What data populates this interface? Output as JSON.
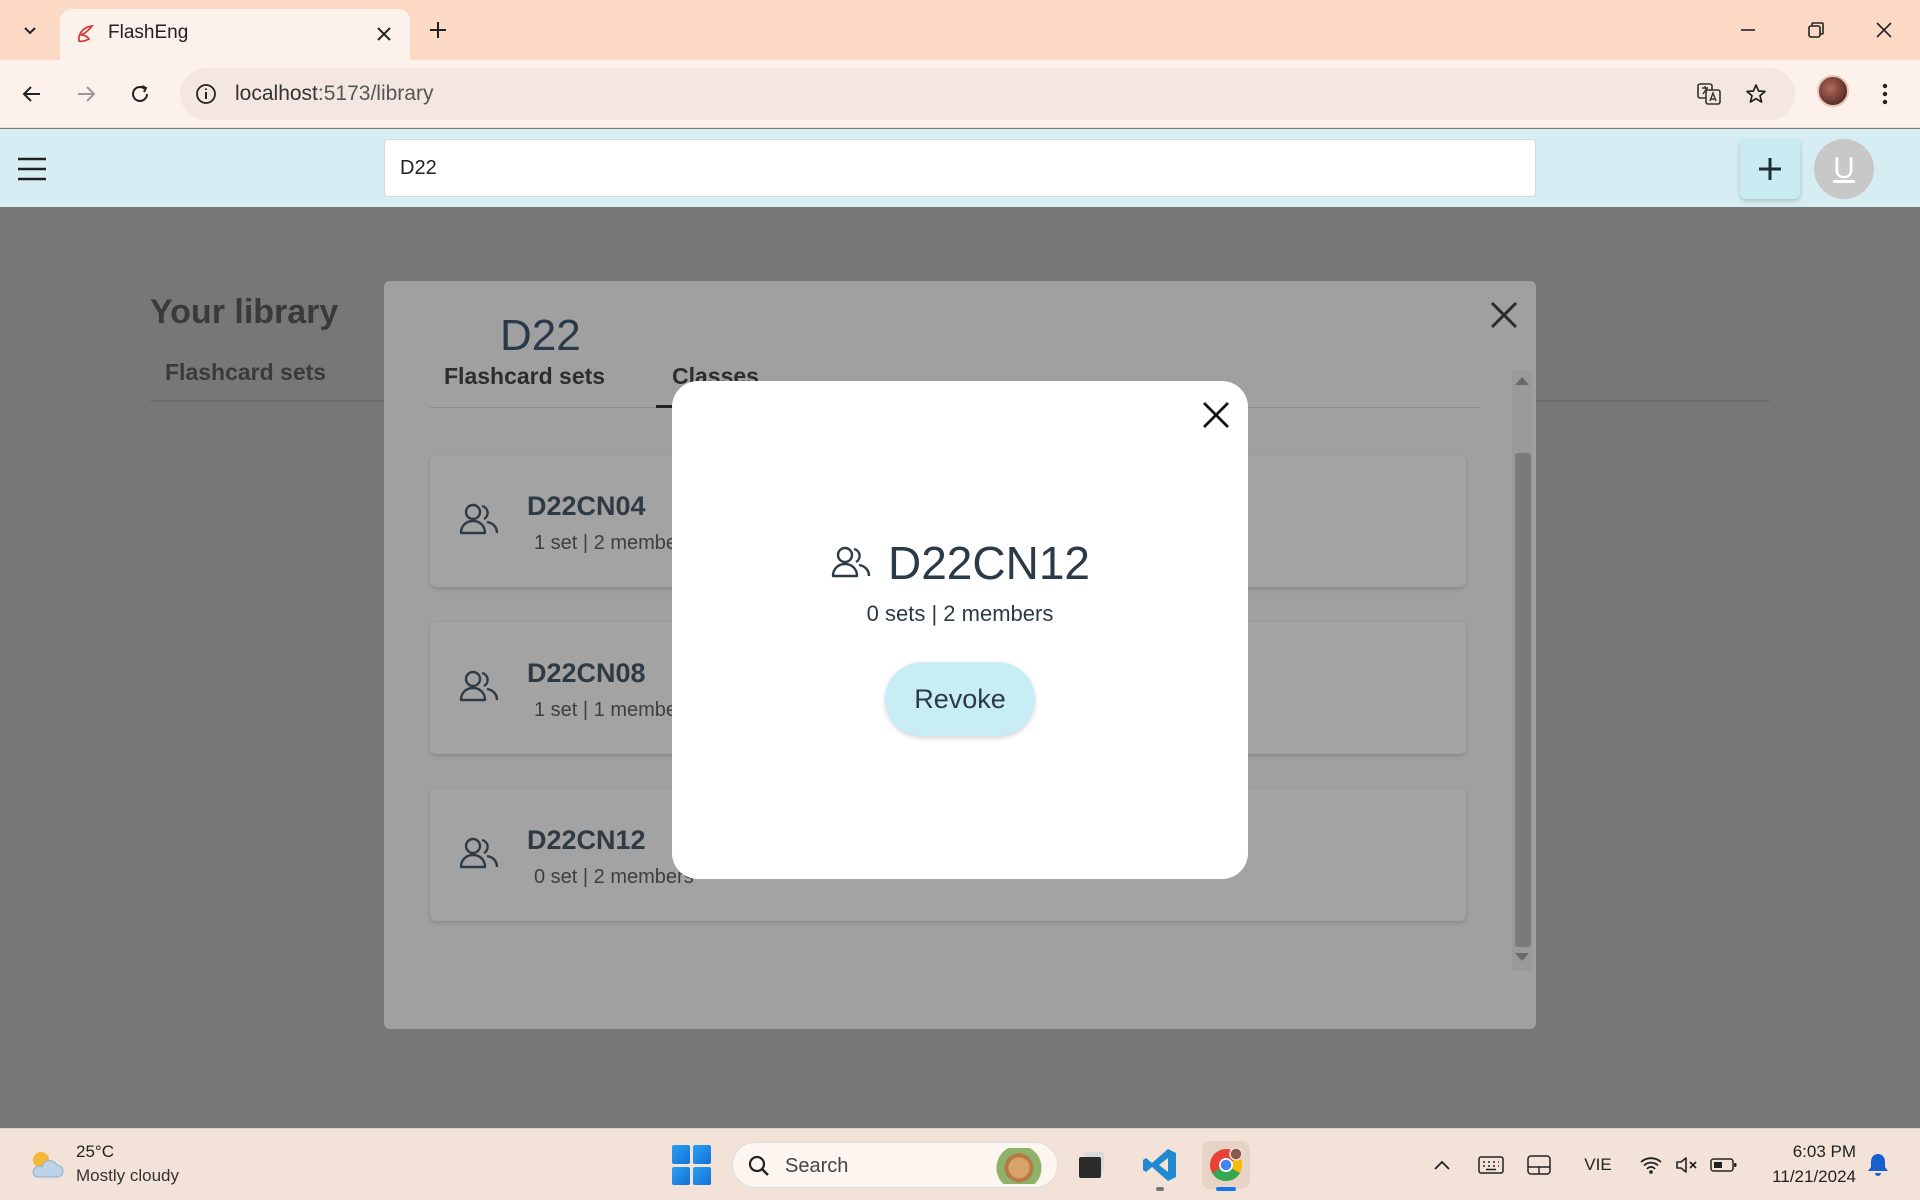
{
  "browser": {
    "tab_title": "FlashEng",
    "url_host": "localhost",
    "url_rest": ":5173/library"
  },
  "header": {
    "search_value": "D22",
    "avatar_letter": "U"
  },
  "library": {
    "title": "Your library",
    "tab_flashcards": "Flashcard sets"
  },
  "results": {
    "title": "D22",
    "tabs": [
      "Flashcard sets",
      "Classes"
    ],
    "active_tab": "Classes",
    "classes": [
      {
        "name": "D22CN04",
        "meta": "1 set | 2 members"
      },
      {
        "name": "D22CN08",
        "meta": "1 set | 1 member"
      },
      {
        "name": "D22CN12",
        "meta": "0 set | 2 members"
      }
    ]
  },
  "popup": {
    "name": "D22CN12",
    "meta": "0 sets | 2 members",
    "revoke_label": "Revoke"
  },
  "taskbar": {
    "temperature": "25°C",
    "weather": "Mostly cloudy",
    "search_label": "Search",
    "language": "VIE",
    "time": "6:03 PM",
    "date": "11/21/2024"
  },
  "colors": {
    "header_bg": "#d6eef3",
    "accent_button": "#c9edf4",
    "overlay": "#777777",
    "tabbar_bg": "#fcd9c5"
  }
}
